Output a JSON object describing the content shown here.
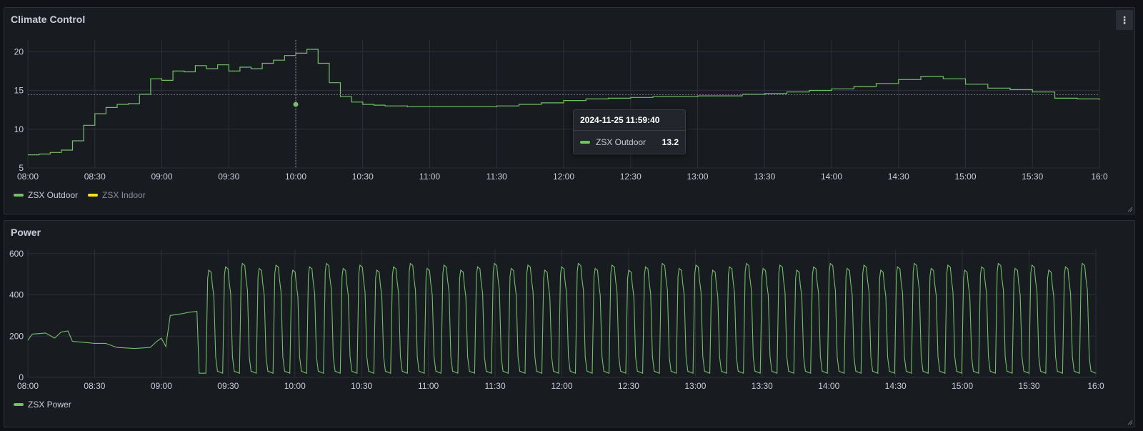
{
  "colors": {
    "background": "#111217",
    "panel": "#181b1f",
    "grid": "#2c2f36",
    "axis_text": "#ccccdc",
    "green": "#73bf69",
    "yellow": "#fade2a"
  },
  "climate": {
    "title": "Climate Control",
    "menu_icon": "⋮",
    "legend": [
      {
        "label": "ZSX Outdoor",
        "color": "#73bf69"
      },
      {
        "label": "ZSX Indoor",
        "color": "#fade2a"
      }
    ],
    "tooltip": {
      "time": "2024-11-25 11:59:40",
      "series": "ZSX Outdoor",
      "value": "13.2"
    },
    "chart_data": {
      "type": "line",
      "x_ticks": [
        "08:00",
        "08:30",
        "09:00",
        "09:30",
        "10:00",
        "10:30",
        "11:00",
        "11:30",
        "12:00",
        "12:30",
        "13:00",
        "13:30",
        "14:00",
        "14:30",
        "15:00",
        "15:30",
        "16:0"
      ],
      "y_ticks": [
        "5",
        "10",
        "15",
        "20"
      ],
      "ylim": [
        5,
        21.5
      ],
      "xlim_minutes": [
        0,
        480
      ],
      "hover_minute": 120,
      "hover_value": 13.9,
      "series": [
        {
          "name": "ZSX Outdoor",
          "color": "#73bf69",
          "x": [
            0,
            5,
            10,
            15,
            20,
            25,
            30,
            35,
            40,
            45,
            50,
            55,
            60,
            65,
            70,
            75,
            80,
            85,
            90,
            95,
            100,
            105,
            110,
            115,
            120,
            125,
            130,
            135,
            140,
            145,
            150,
            155,
            160,
            170,
            180,
            190,
            200,
            210,
            220,
            230,
            240,
            250,
            260,
            270,
            280,
            290,
            300,
            310,
            320,
            330,
            340,
            350,
            360,
            370,
            380,
            390,
            400,
            410,
            420,
            430,
            440,
            450,
            460,
            470,
            480
          ],
          "values": [
            6.7,
            6.8,
            7,
            7.3,
            8.5,
            10.5,
            12.0,
            12.8,
            13.2,
            13.3,
            14.5,
            16.5,
            16.3,
            17.5,
            17.4,
            18.2,
            17.8,
            18.3,
            17.5,
            18,
            17.8,
            18.5,
            18.9,
            19.5,
            19.8,
            20.3,
            18.5,
            16,
            14.2,
            13.5,
            13.2,
            13.1,
            13,
            12.9,
            12.9,
            12.9,
            12.9,
            13.0,
            13.2,
            13.4,
            13.7,
            13.9,
            14.0,
            14.1,
            14.2,
            14.2,
            14.3,
            14.3,
            14.5,
            14.6,
            14.8,
            15.0,
            15.2,
            15.5,
            15.9,
            16.4,
            16.8,
            16.5,
            15.8,
            15.3,
            15.1,
            14.8,
            14.0,
            13.9,
            13.8
          ]
        }
      ]
    }
  },
  "power": {
    "title": "Power",
    "legend": [
      {
        "label": "ZSX Power",
        "color": "#73bf69"
      }
    ],
    "chart_data": {
      "type": "line",
      "x_ticks": [
        "08:00",
        "08:30",
        "09:00",
        "09:30",
        "10:00",
        "10:30",
        "11:00",
        "11:30",
        "12:00",
        "12:30",
        "13:00",
        "13:30",
        "14:00",
        "14:30",
        "15:00",
        "15:30",
        "16:0"
      ],
      "y_ticks": [
        "0",
        "200",
        "400",
        "600"
      ],
      "ylim": [
        0,
        620
      ],
      "xlim_minutes": [
        0,
        480
      ],
      "pre_cycle_points": [
        [
          0,
          180
        ],
        [
          2,
          210
        ],
        [
          8,
          215
        ],
        [
          12,
          190
        ],
        [
          15,
          220
        ],
        [
          18,
          225
        ],
        [
          20,
          175
        ],
        [
          25,
          170
        ],
        [
          30,
          165
        ],
        [
          35,
          165
        ],
        [
          40,
          145
        ],
        [
          48,
          140
        ],
        [
          55,
          145
        ],
        [
          58,
          175
        ],
        [
          60,
          190
        ],
        [
          62,
          150
        ],
        [
          64,
          300
        ],
        [
          70,
          310
        ],
        [
          72,
          315
        ],
        [
          76,
          320
        ],
        [
          77,
          20
        ]
      ],
      "cycle": {
        "start_minute": 80,
        "period_minutes": 7.55,
        "count": 53,
        "peak": 520,
        "low": 20
      }
    }
  }
}
